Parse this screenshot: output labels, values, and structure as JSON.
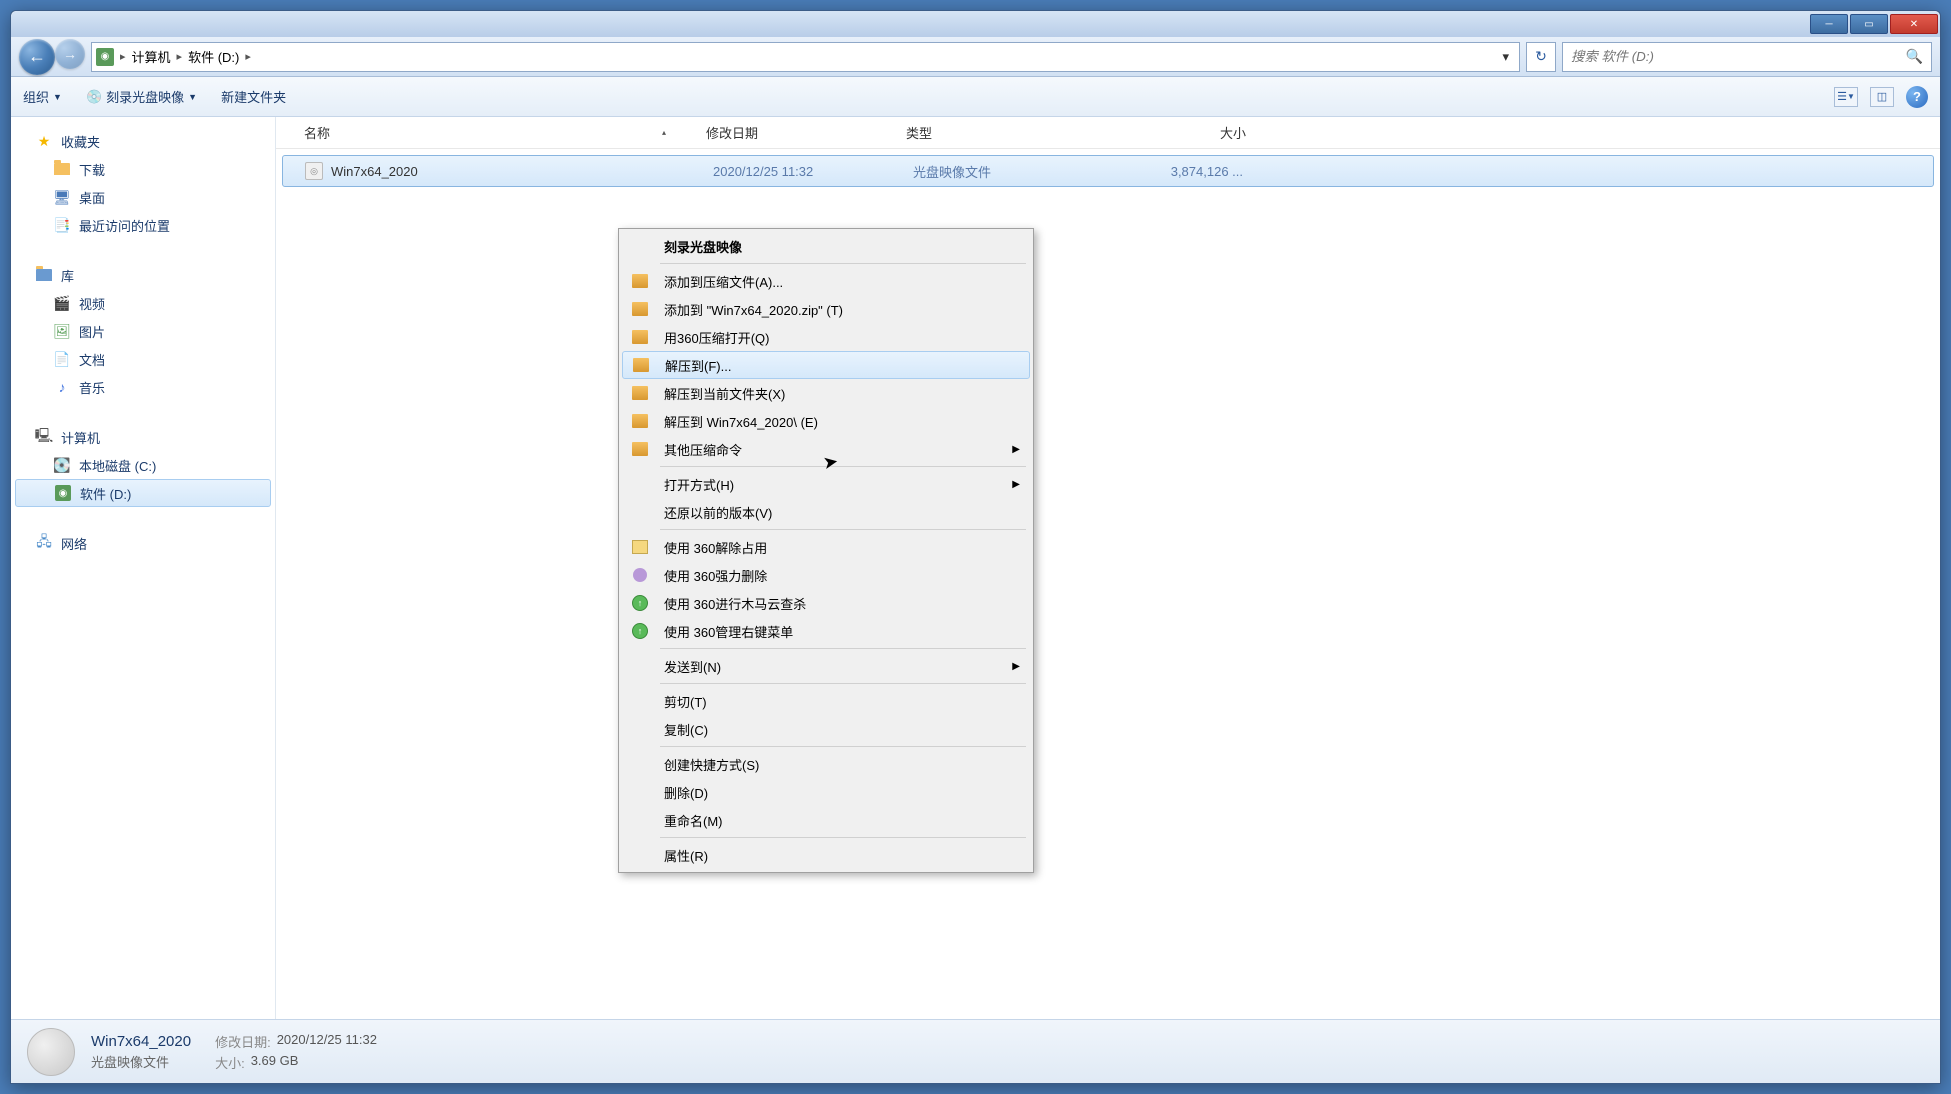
{
  "titlebar": {},
  "breadcrumb": {
    "item1": "计算机",
    "item2": "软件 (D:)"
  },
  "search": {
    "placeholder": "搜索 软件 (D:)"
  },
  "toolbar": {
    "organize": "组织",
    "burn": "刻录光盘映像",
    "newfolder": "新建文件夹"
  },
  "sidebar": {
    "favorites": "收藏夹",
    "downloads": "下载",
    "desktop": "桌面",
    "recent": "最近访问的位置",
    "libraries": "库",
    "videos": "视频",
    "pictures": "图片",
    "documents": "文档",
    "music": "音乐",
    "computer": "计算机",
    "localc": "本地磁盘 (C:)",
    "software": "软件 (D:)",
    "network": "网络"
  },
  "columns": {
    "name": "名称",
    "date": "修改日期",
    "type": "类型",
    "size": "大小"
  },
  "file": {
    "name": "Win7x64_2020",
    "date": "2020/12/25 11:32",
    "type": "光盘映像文件",
    "size": "3,874,126 ..."
  },
  "context": {
    "burn": "刻录光盘映像",
    "addto_archive": "添加到压缩文件(A)...",
    "addto_zip": "添加到 \"Win7x64_2020.zip\" (T)",
    "open360": "用360压缩打开(Q)",
    "extractto": "解压到(F)...",
    "extract_here": "解压到当前文件夹(X)",
    "extract_named": "解压到 Win7x64_2020\\ (E)",
    "other_compress": "其他压缩命令",
    "openwith": "打开方式(H)",
    "restore": "还原以前的版本(V)",
    "unlock360": "使用 360解除占用",
    "forcedel360": "使用 360强力删除",
    "scan360": "使用 360进行木马云查杀",
    "manage360": "使用 360管理右键菜单",
    "sendto": "发送到(N)",
    "cut": "剪切(T)",
    "copy": "复制(C)",
    "shortcut": "创建快捷方式(S)",
    "delete": "删除(D)",
    "rename": "重命名(M)",
    "properties": "属性(R)"
  },
  "status": {
    "title": "Win7x64_2020",
    "type": "光盘映像文件",
    "date_label": "修改日期:",
    "date": "2020/12/25 11:32",
    "size_label": "大小:",
    "size": "3.69 GB"
  }
}
